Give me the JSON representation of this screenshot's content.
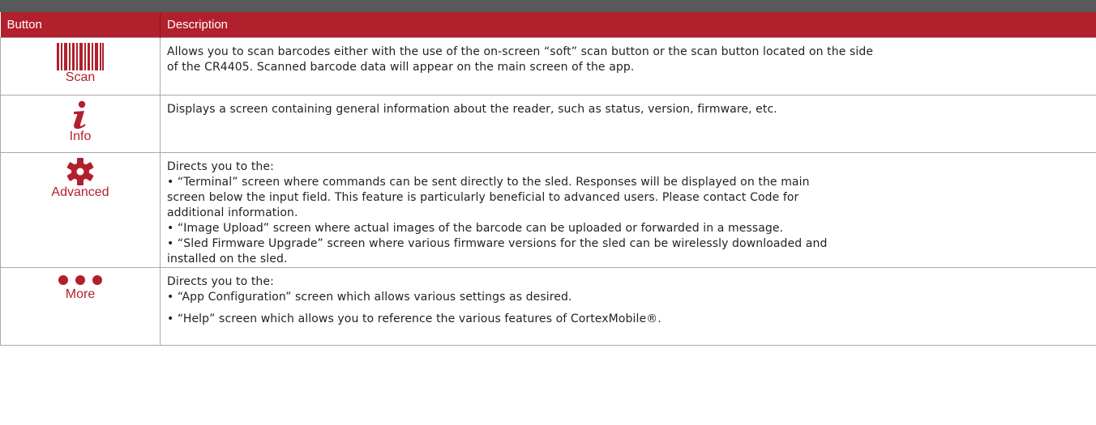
{
  "header": {
    "col_button": "Button",
    "col_description": "Description"
  },
  "rows": [
    {
      "icon": "barcode-icon",
      "label": "Scan",
      "lines": [
        "Allows you to scan barcodes either with the use of the on-screen “soft” scan button or the scan button located on the side",
        "of the CR4405. Scanned barcode data will appear on the main screen of the app."
      ]
    },
    {
      "icon": "info-icon",
      "label": "Info",
      "lines": [
        "Displays a screen containing general information about the reader, such as status, version, firmware, etc."
      ]
    },
    {
      "icon": "gear-icon",
      "label": "Advanced",
      "lines": [
        "Directs you to the:",
        "• “Terminal” screen where commands can be sent directly to the sled. Responses will be displayed on the main",
        "screen below the input field. This feature is particularly beneficial to advanced users. Please contact Code for",
        "additional information.",
        "• “Image Upload” screen where actual images of the barcode can be uploaded or forwarded in a message.",
        "• “Sled Firmware Upgrade” screen where various firmware versions for the sled can be wirelessly downloaded and",
        "installed on the sled."
      ]
    },
    {
      "icon": "more-dots-icon",
      "label": "More",
      "lines": [
        "Directs you to the:",
        "• “App Configuration” screen which allows various settings as desired.",
        "• “Help” screen which allows you to reference the various features of CortexMobile®."
      ]
    }
  ],
  "colors": {
    "accent": "#b21f2d",
    "topbar": "#58595b",
    "border": "#a7a9ac"
  }
}
